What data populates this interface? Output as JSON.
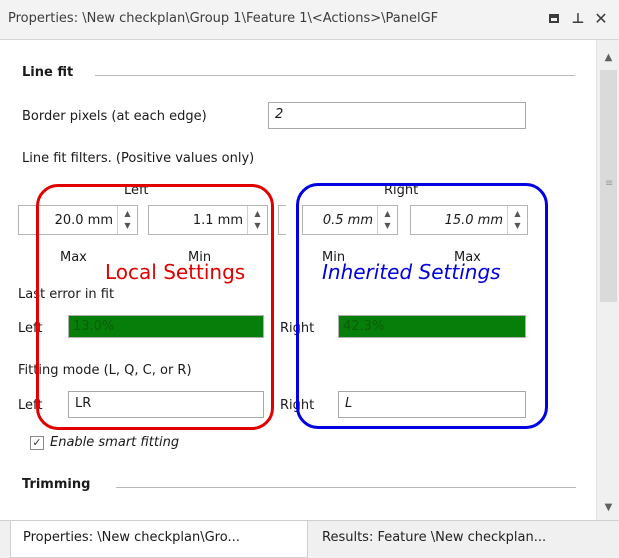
{
  "title": "Properties: \\New checkplan\\Group 1\\Feature 1\\<Actions>\\PanelGF",
  "titlebar_icons": [
    "maximize-icon",
    "pin-icon",
    "close-icon"
  ],
  "line_fit": {
    "section_title": "Line fit",
    "border_pixels_label": "Border pixels (at each edge)",
    "border_pixels_value": "2",
    "filters_label": "Line fit filters.  (Positive values only)",
    "left_header": "Left",
    "right_header": "Right",
    "spinners": [
      {
        "value": "20.0 mm",
        "italic": false
      },
      {
        "value": "1.1 mm",
        "italic": false
      },
      {
        "value": "0.5 mm",
        "italic": true
      },
      {
        "value": "15.0 mm",
        "italic": true
      }
    ],
    "spin_labels": [
      "Max",
      "Min",
      "Min",
      "Max"
    ],
    "last_error_label": "Last error in fit",
    "left_label": "Left",
    "right_label": "Right",
    "left_error": "13.0%",
    "right_error": "42.3%",
    "left_error_fraction": 0.13,
    "right_error_fraction": 0.423,
    "fitting_mode_label": "Fitting mode (L, Q, C, or R)",
    "fitting_left_value": "LR",
    "fitting_right_value": "L",
    "smart_fitting_label": "Enable smart fitting",
    "smart_fitting_checked": true
  },
  "trimming": {
    "section_title": "Trimming"
  },
  "annotations": {
    "local_label": "Local Settings",
    "local_color": "#e00000",
    "inherited_label": "Inherited Settings",
    "inherited_color": "#0000e0"
  },
  "colors": {
    "progress_fill": "#077d0a"
  },
  "bottom_tabs": [
    "Properties: \\New checkplan\\Gro...",
    "Results: Feature \\New checkplan..."
  ]
}
